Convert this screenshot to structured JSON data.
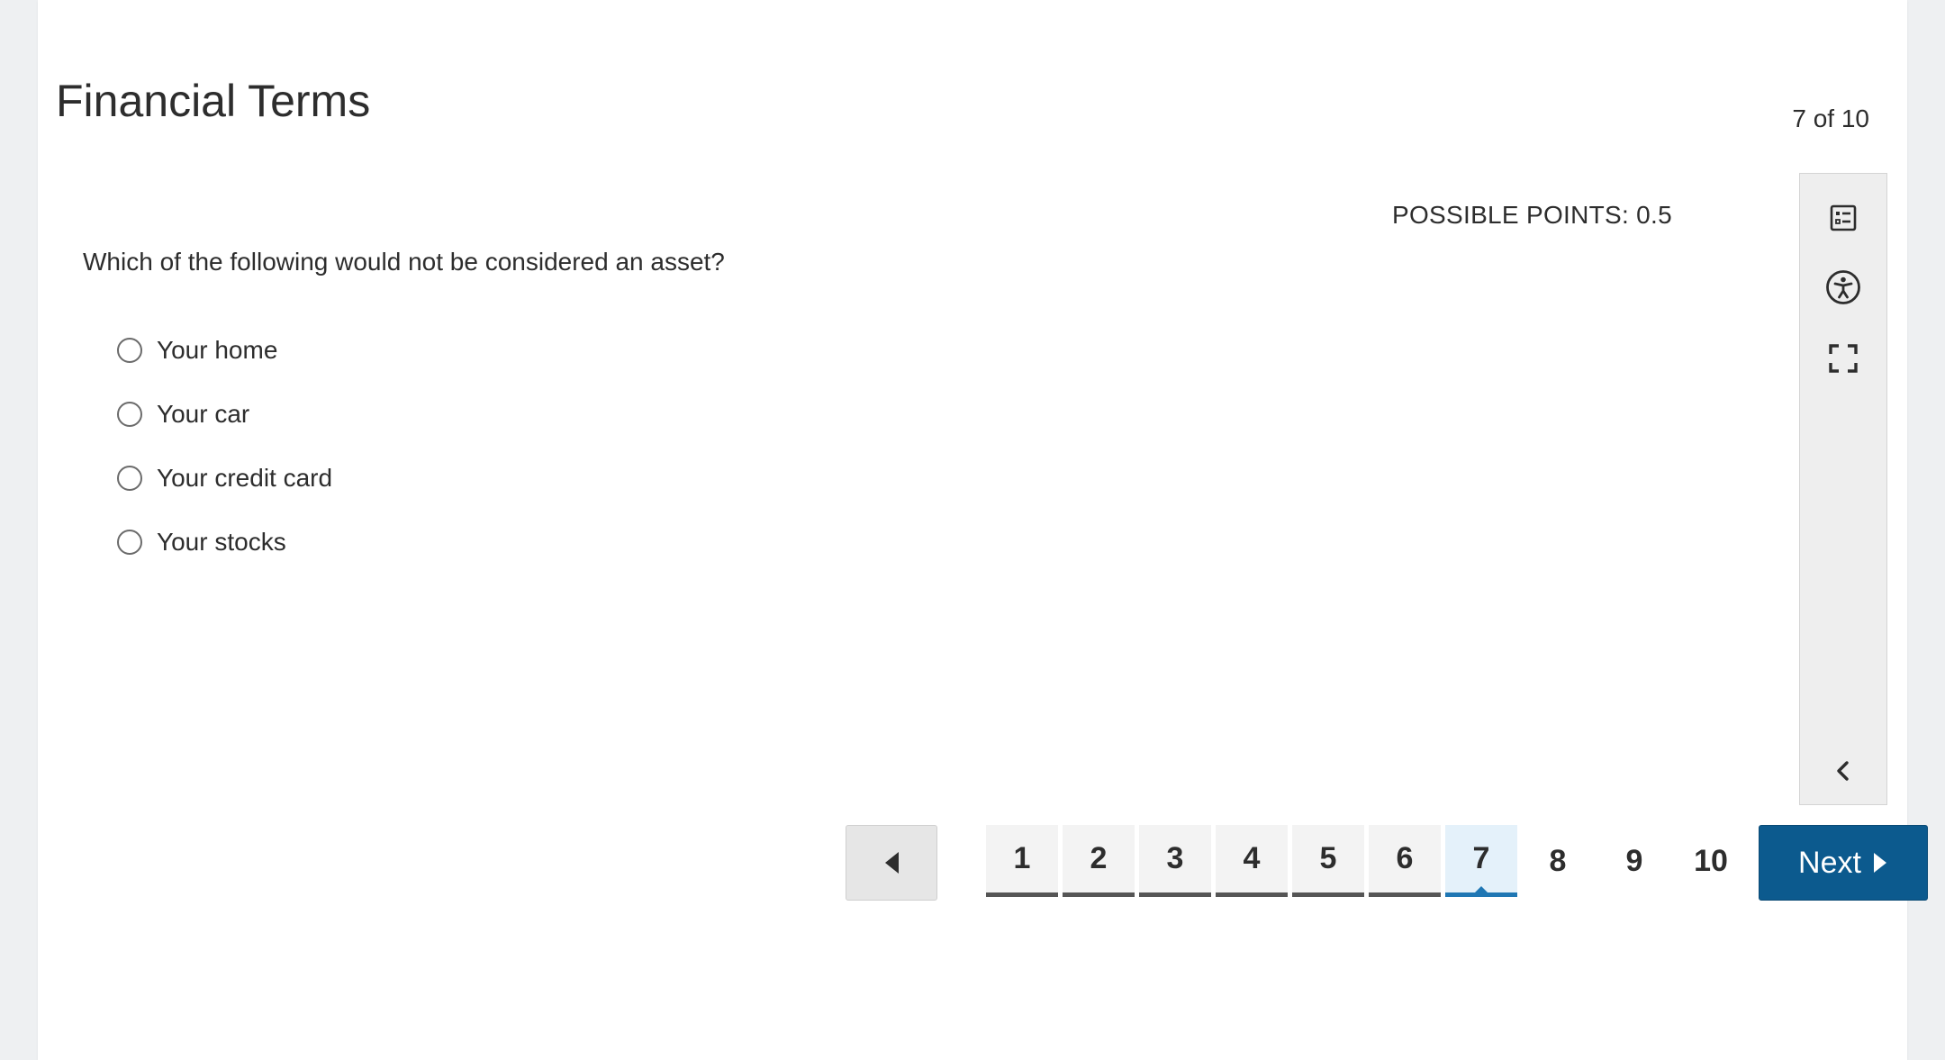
{
  "header": {
    "title": "Financial Terms",
    "counter": "7 of 10"
  },
  "question": {
    "points": "POSSIBLE POINTS: 0.5",
    "text": "Which of the following would not be considered an asset?",
    "options": [
      {
        "label": "Your home",
        "selected": false
      },
      {
        "label": "Your car",
        "selected": false
      },
      {
        "label": "Your credit card",
        "selected": false
      },
      {
        "label": "Your stocks",
        "selected": false
      }
    ]
  },
  "toolbar": {
    "items": [
      "form-icon",
      "accessibility-icon",
      "fullscreen-icon",
      "chevron-left-icon"
    ]
  },
  "pagination": {
    "pages": [
      "1",
      "2",
      "3",
      "4",
      "5",
      "6",
      "7",
      "8",
      "9",
      "10"
    ],
    "current": 7,
    "visited": [
      1,
      2,
      3,
      4,
      5,
      6
    ],
    "next_label": "Next"
  },
  "colors": {
    "accent": "#0c5a8e",
    "current_underline": "#1f77b4",
    "visited_underline": "#555555"
  }
}
